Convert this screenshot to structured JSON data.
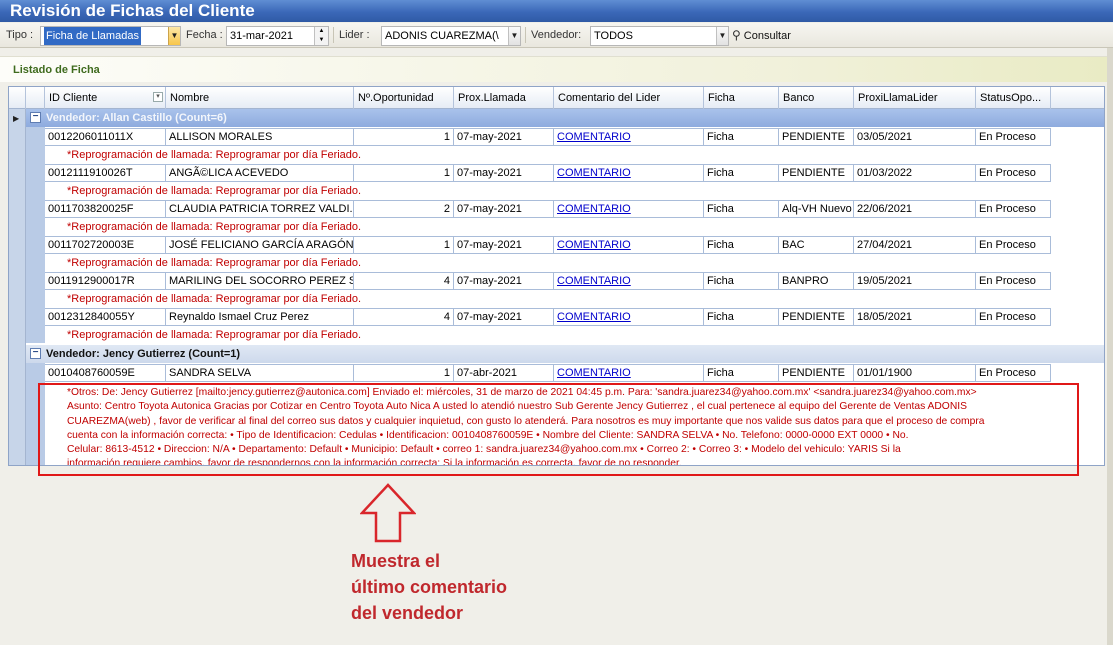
{
  "window": {
    "title": "Revisión de Fichas del Cliente"
  },
  "toolbar": {
    "tipo_label": "Tipo :",
    "tipo_value": "Ficha de Llamadas",
    "fecha_label": "Fecha :",
    "fecha_value": "31-mar-2021",
    "lider_label": "Lider :",
    "lider_value": "ADONIS CUAREZMA(\\",
    "vendedor_label": "Vendedor:",
    "vendedor_value": "TODOS",
    "consultar_label": "Consultar",
    "consultar_icon": "binoculars-icon"
  },
  "panel": {
    "title": "Listado de Ficha"
  },
  "columns": [
    "ID Cliente",
    "Nombre",
    "Nº.Oportunidad",
    "Prox.Llamada",
    "Comentario del Lider",
    "Ficha",
    "Banco",
    "ProxiLlamaLider",
    "StatusOpo..."
  ],
  "groups": [
    {
      "label": "Vendedor: Allan Castillo (Count=6)",
      "rows": [
        {
          "id": "0012206011011X",
          "nombre": "ALLISON MORALES",
          "oportunidad": "1",
          "prox_llamada": "07-may-2021",
          "comentario": "COMENTARIO",
          "ficha": "Ficha",
          "banco": "PENDIENTE",
          "proxi_lider": "03/05/2021",
          "status": "En Proceso",
          "preview": "*Reprogramación de llamada: Reprogramar por día Feriado."
        },
        {
          "id": "0012111910026T",
          "nombre": "ANGÃ©LICA ACEVEDO",
          "oportunidad": "1",
          "prox_llamada": "07-may-2021",
          "comentario": "COMENTARIO",
          "ficha": "Ficha",
          "banco": "PENDIENTE",
          "proxi_lider": "01/03/2022",
          "status": "En Proceso",
          "preview": "*Reprogramación de llamada: Reprogramar por día Feriado."
        },
        {
          "id": "0011703820025F",
          "nombre": "CLAUDIA PATRICIA TORREZ VALDI...",
          "oportunidad": "2",
          "prox_llamada": "07-may-2021",
          "comentario": "COMENTARIO",
          "ficha": "Ficha",
          "banco": "Alq-VH Nuevo",
          "proxi_lider": "22/06/2021",
          "status": "En Proceso",
          "preview": "*Reprogramación de llamada: Reprogramar por día Feriado."
        },
        {
          "id": "0011702720003E",
          "nombre": "JOSÉ FELICIANO GARCÍA ARAGÓN",
          "oportunidad": "1",
          "prox_llamada": "07-may-2021",
          "comentario": "COMENTARIO",
          "ficha": "Ficha",
          "banco": "BAC",
          "proxi_lider": "27/04/2021",
          "status": "En Proceso",
          "preview": "*Reprogramación de llamada: Reprogramar por día Feriado."
        },
        {
          "id": "0011912900017R",
          "nombre": "MARILING DEL SOCORRO PEREZ S...",
          "oportunidad": "4",
          "prox_llamada": "07-may-2021",
          "comentario": "COMENTARIO",
          "ficha": "Ficha",
          "banco": "BANPRO",
          "proxi_lider": "19/05/2021",
          "status": "En Proceso",
          "preview": "*Reprogramación de llamada: Reprogramar por día Feriado."
        },
        {
          "id": "0012312840055Y",
          "nombre": "Reynaldo Ismael Cruz Perez",
          "oportunidad": "4",
          "prox_llamada": "07-may-2021",
          "comentario": "COMENTARIO",
          "ficha": "Ficha",
          "banco": "PENDIENTE",
          "proxi_lider": "18/05/2021",
          "status": "En Proceso",
          "preview": "*Reprogramación de llamada: Reprogramar por día Feriado."
        }
      ]
    },
    {
      "label": "Vendedor: Jency Gutierrez (Count=1)",
      "rows": [
        {
          "id": "0010408760059E",
          "nombre": "SANDRA SELVA",
          "oportunidad": "1",
          "prox_llamada": "07-abr-2021",
          "comentario": "COMENTARIO",
          "ficha": "Ficha",
          "banco": "PENDIENTE",
          "proxi_lider": "01/01/1900",
          "status": "En Proceso",
          "preview_lines": [
            "*Otros: De: Jency Gutierrez [mailto:jency.gutierrez@autonica.com]  Enviado el: miércoles, 31 de marzo de 2021 04:45 p.m.  Para: 'sandra.juarez34@yahoo.com.mx' <sandra.juarez34@yahoo.com.mx>",
            "Asunto: Centro Toyota Autonica   Gracias por Cotizar en Centro Toyota Auto Nica   A usted lo atendió nuestro Sub Gerente Jency Gutierrez , el cual pertenece al equipo del Gerente de Ventas ADONIS",
            "CUAREZMA(web) , favor de verificar al final del correo sus datos y cualquier inquietud, con gusto lo atenderá.   Para nosotros es muy importante que nos valide sus datos para que el proceso de compra",
            "cuenta con la información correcta:   •   Tipo de Identificacion: Cedulas  •   Identificacion: 0010408760059E  •   Nombre del Cliente: SANDRA SELVA  •   No. Telefono: 0000-0000 EXT 0000   •   No.",
            "Celular: 8613-4512  •   Direccion: N/A  •   Departamento: Default  •   Municipio: Default  •   correo 1: sandra.juarez34@yahoo.com.mx  •   Correo 2:   •   Correo 3:   •   Modelo del vehiculo: YARIS  Si la",
            "información requiere cambios, favor de respondernos con la información correcta:   Si la información es correcta, favor de no responder."
          ]
        }
      ]
    }
  ],
  "annotation": {
    "lines": [
      "Muestra el",
      "último comentario",
      "del vendedor"
    ],
    "color": "#c0282d"
  }
}
